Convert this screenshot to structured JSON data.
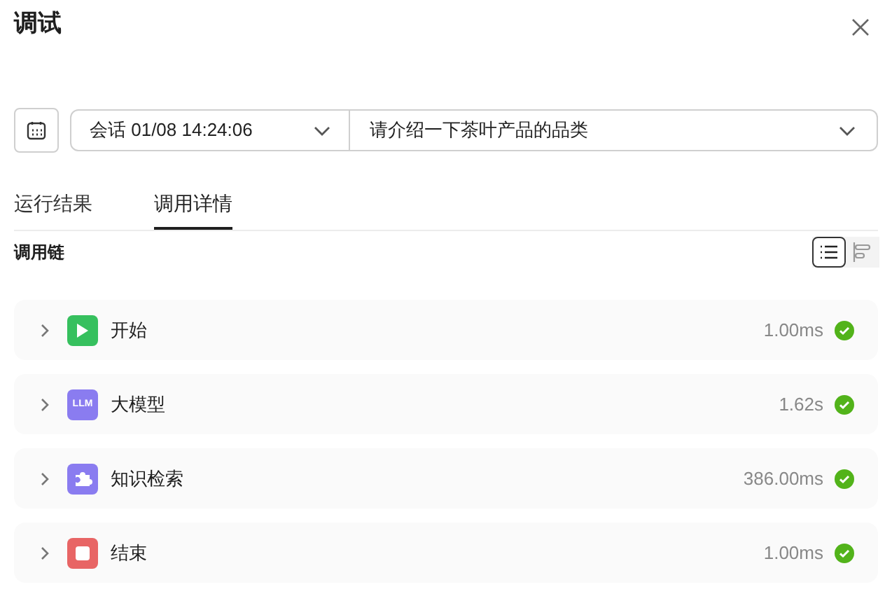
{
  "title": "调试",
  "session_select": {
    "value": "会话 01/08 14:24:06"
  },
  "question_select": {
    "value": "请介绍一下茶叶产品的品类"
  },
  "tabs": [
    {
      "label": "运行结果",
      "selected": false
    },
    {
      "label": "调用详情",
      "selected": true
    }
  ],
  "section_title": "调用链",
  "view_toggle": [
    {
      "kind": "list",
      "selected": true
    },
    {
      "kind": "timeline",
      "selected": false
    }
  ],
  "steps": [
    {
      "kind": "start",
      "name": "开始",
      "duration": "1.00ms",
      "succeeded": true,
      "expanded": false
    },
    {
      "kind": "llm",
      "icon_text": "LLM",
      "name": "大模型",
      "duration": "1.62s",
      "succeeded": true,
      "expanded": false
    },
    {
      "kind": "knowledge",
      "name": "知识检索",
      "duration": "386.00ms",
      "succeeded": true,
      "expanded": false
    },
    {
      "kind": "end",
      "name": "结束",
      "duration": "1.00ms",
      "succeeded": true,
      "expanded": false
    }
  ]
}
